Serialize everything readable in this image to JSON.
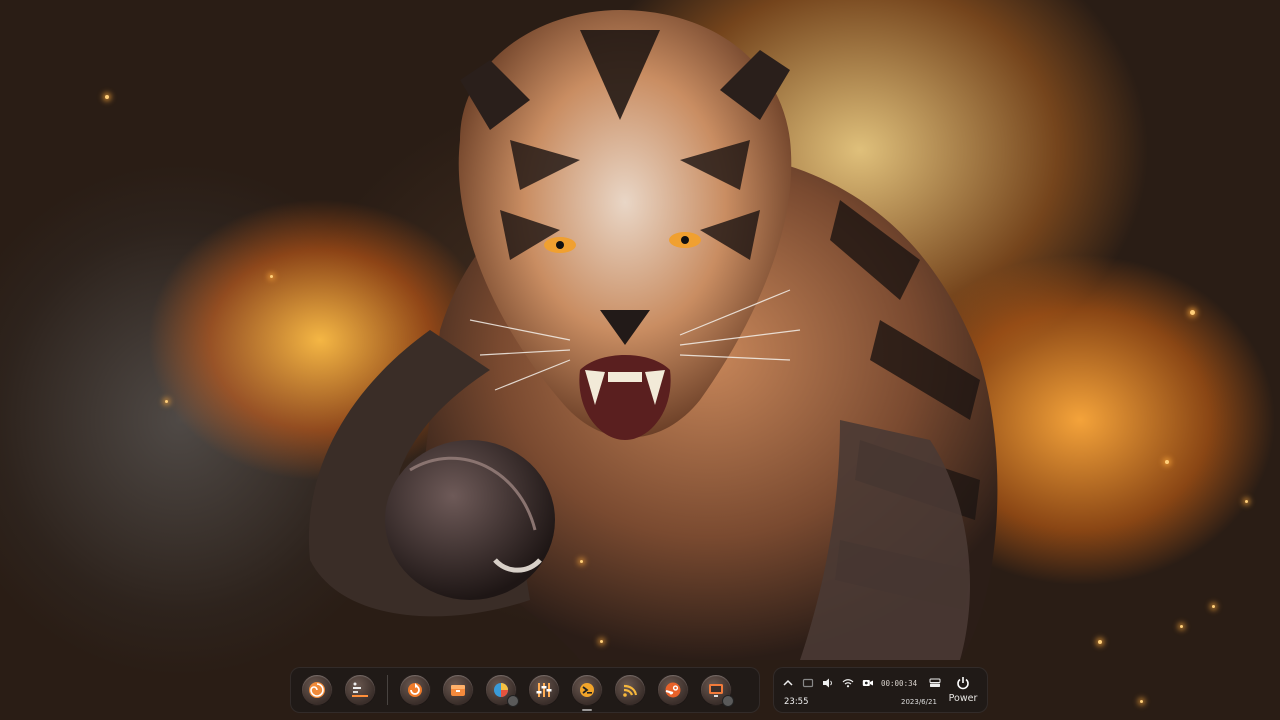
{
  "desktop": {
    "wallpaper": "tiger-football-wallpaper",
    "accent_color": "#ff9a2e"
  },
  "dock": {
    "apps": [
      {
        "name": "multitasking-view",
        "icon": "spiral-icon"
      },
      {
        "name": "launcher",
        "icon": "launcher-icon"
      },
      {
        "name": "refresh-app",
        "icon": "circular-arrow-icon"
      },
      {
        "name": "app-store",
        "icon": "box-icon"
      },
      {
        "name": "pie-app",
        "icon": "pie-icon"
      },
      {
        "name": "equalizer-app",
        "icon": "equalizer-icon"
      },
      {
        "name": "terminal-app",
        "icon": "terminal-icon"
      },
      {
        "name": "rss-app",
        "icon": "rss-icon"
      },
      {
        "name": "steam-app",
        "icon": "steam-icon"
      },
      {
        "name": "screen-app",
        "icon": "monitor-icon"
      }
    ]
  },
  "tray": {
    "record_time": "00:00:34",
    "time": "23:55",
    "date": "2023/6/21",
    "power_label": "Power"
  }
}
